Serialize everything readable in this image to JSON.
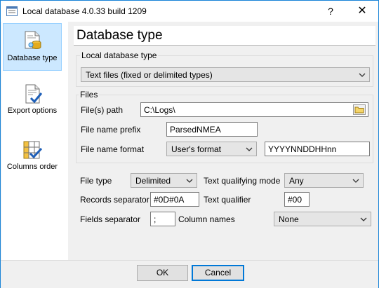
{
  "window": {
    "title": "Local database 4.0.33 build 1209",
    "help_label": "?",
    "close_label": "✕"
  },
  "sidebar": {
    "items": [
      {
        "label": "Database type",
        "icon": "database-icon",
        "selected": true
      },
      {
        "label": "Export options",
        "icon": "document-check-icon",
        "selected": false
      },
      {
        "label": "Columns order",
        "icon": "columns-check-icon",
        "selected": false
      }
    ]
  },
  "page": {
    "title": "Database type"
  },
  "local_db": {
    "legend": "Local database type",
    "value": "Text files (fixed or delimited types)"
  },
  "files": {
    "legend": "Files",
    "path_label": "File(s) path",
    "path_value": "C:\\Logs\\",
    "prefix_label": "File name prefix",
    "prefix_value": "ParsedNMEA",
    "format_label": "File name format",
    "format_select": "User's format",
    "format_value": "YYYYNNDDHHnn"
  },
  "options": {
    "file_type_label": "File type",
    "file_type_value": "Delimited",
    "text_qual_mode_label": "Text qualifying mode",
    "text_qual_mode_value": "Any",
    "records_sep_label": "Records separator",
    "records_sep_value": "#0D#0A",
    "text_qualifier_label": "Text qualifier",
    "text_qualifier_value": "#00",
    "fields_sep_label": "Fields separator",
    "fields_sep_value": ";",
    "column_names_label": "Column names",
    "column_names_value": "None"
  },
  "buttons": {
    "ok": "OK",
    "cancel": "Cancel"
  },
  "colors": {
    "selection": "#cce8ff",
    "selection_border": "#99d1ff",
    "accent": "#0078d7"
  }
}
